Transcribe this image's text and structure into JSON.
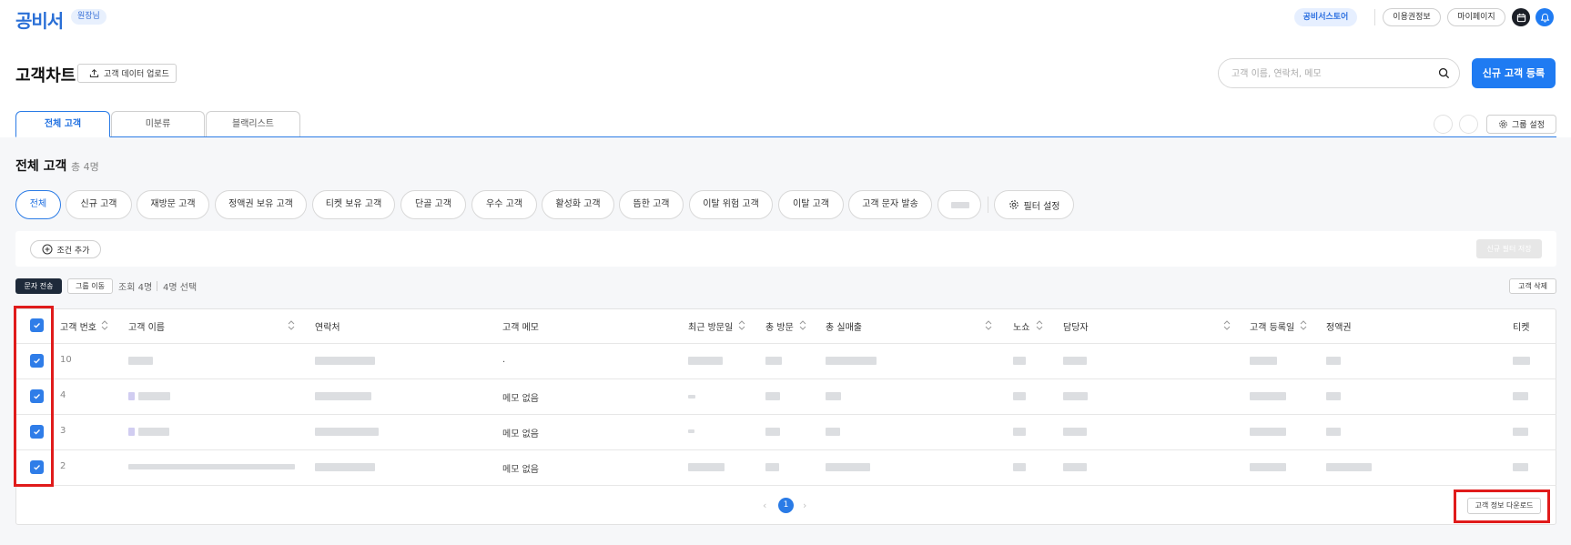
{
  "header": {
    "logo": "공비서",
    "role_badge": "원장님",
    "store_button": "공비서스토어",
    "plan_button": "이용권정보",
    "mypage_button": "마이페이지"
  },
  "page": {
    "title": "고객차트",
    "upload_button": "고객 데이터 업로드",
    "search_placeholder": "고객 이름, 연락처, 메모",
    "new_customer_button": "신규 고객 등록"
  },
  "tabs": [
    {
      "label": "전체 고객"
    },
    {
      "label": "미분류"
    },
    {
      "label": "블랙리스트"
    }
  ],
  "group_settings_button": "그룹 설정",
  "section": {
    "title": "전체 고객",
    "count": "총 4명"
  },
  "filter_chips": [
    {
      "label": "전체"
    },
    {
      "label": "신규 고객"
    },
    {
      "label": "재방문 고객"
    },
    {
      "label": "정액권 보유 고객"
    },
    {
      "label": "티켓 보유 고객"
    },
    {
      "label": "단골 고객"
    },
    {
      "label": "우수 고객"
    },
    {
      "label": "활성화 고객"
    },
    {
      "label": "뜸한 고객"
    },
    {
      "label": "이탈 위험 고객"
    },
    {
      "label": "이탈 고객"
    },
    {
      "label": "고객 문자 발송"
    }
  ],
  "filter_settings_button": "필터 설정",
  "conditions": {
    "add_condition_button": "조건 추가",
    "save_filter_button": "신규 필터 저장"
  },
  "actions": {
    "send_sms": "문자 전송",
    "move_group": "그룹 이동",
    "result_count": "조회 4명",
    "selected_count": "4명 선택",
    "delete_customer": "고객 삭제"
  },
  "table": {
    "columns": [
      "고객 번호",
      "고객 이름",
      "연락처",
      "고객 메모",
      "최근 방문일",
      "총 방문",
      "총 실매출",
      "노쇼",
      "담당자",
      "고객 등록일",
      "정액권",
      "티켓"
    ],
    "rows": [
      {
        "number": "10",
        "memo": "."
      },
      {
        "number": "4",
        "memo": "메모 없음"
      },
      {
        "number": "3",
        "memo": "메모 없음"
      },
      {
        "number": "2",
        "memo": "메모 없음"
      }
    ]
  },
  "pagination": {
    "current_page": "1",
    "prev": "‹",
    "next": "›"
  },
  "download_button": "고객 정보 다운로드",
  "colors": {
    "accent": "#1f7bf2",
    "highlight": "#e01b1b"
  }
}
